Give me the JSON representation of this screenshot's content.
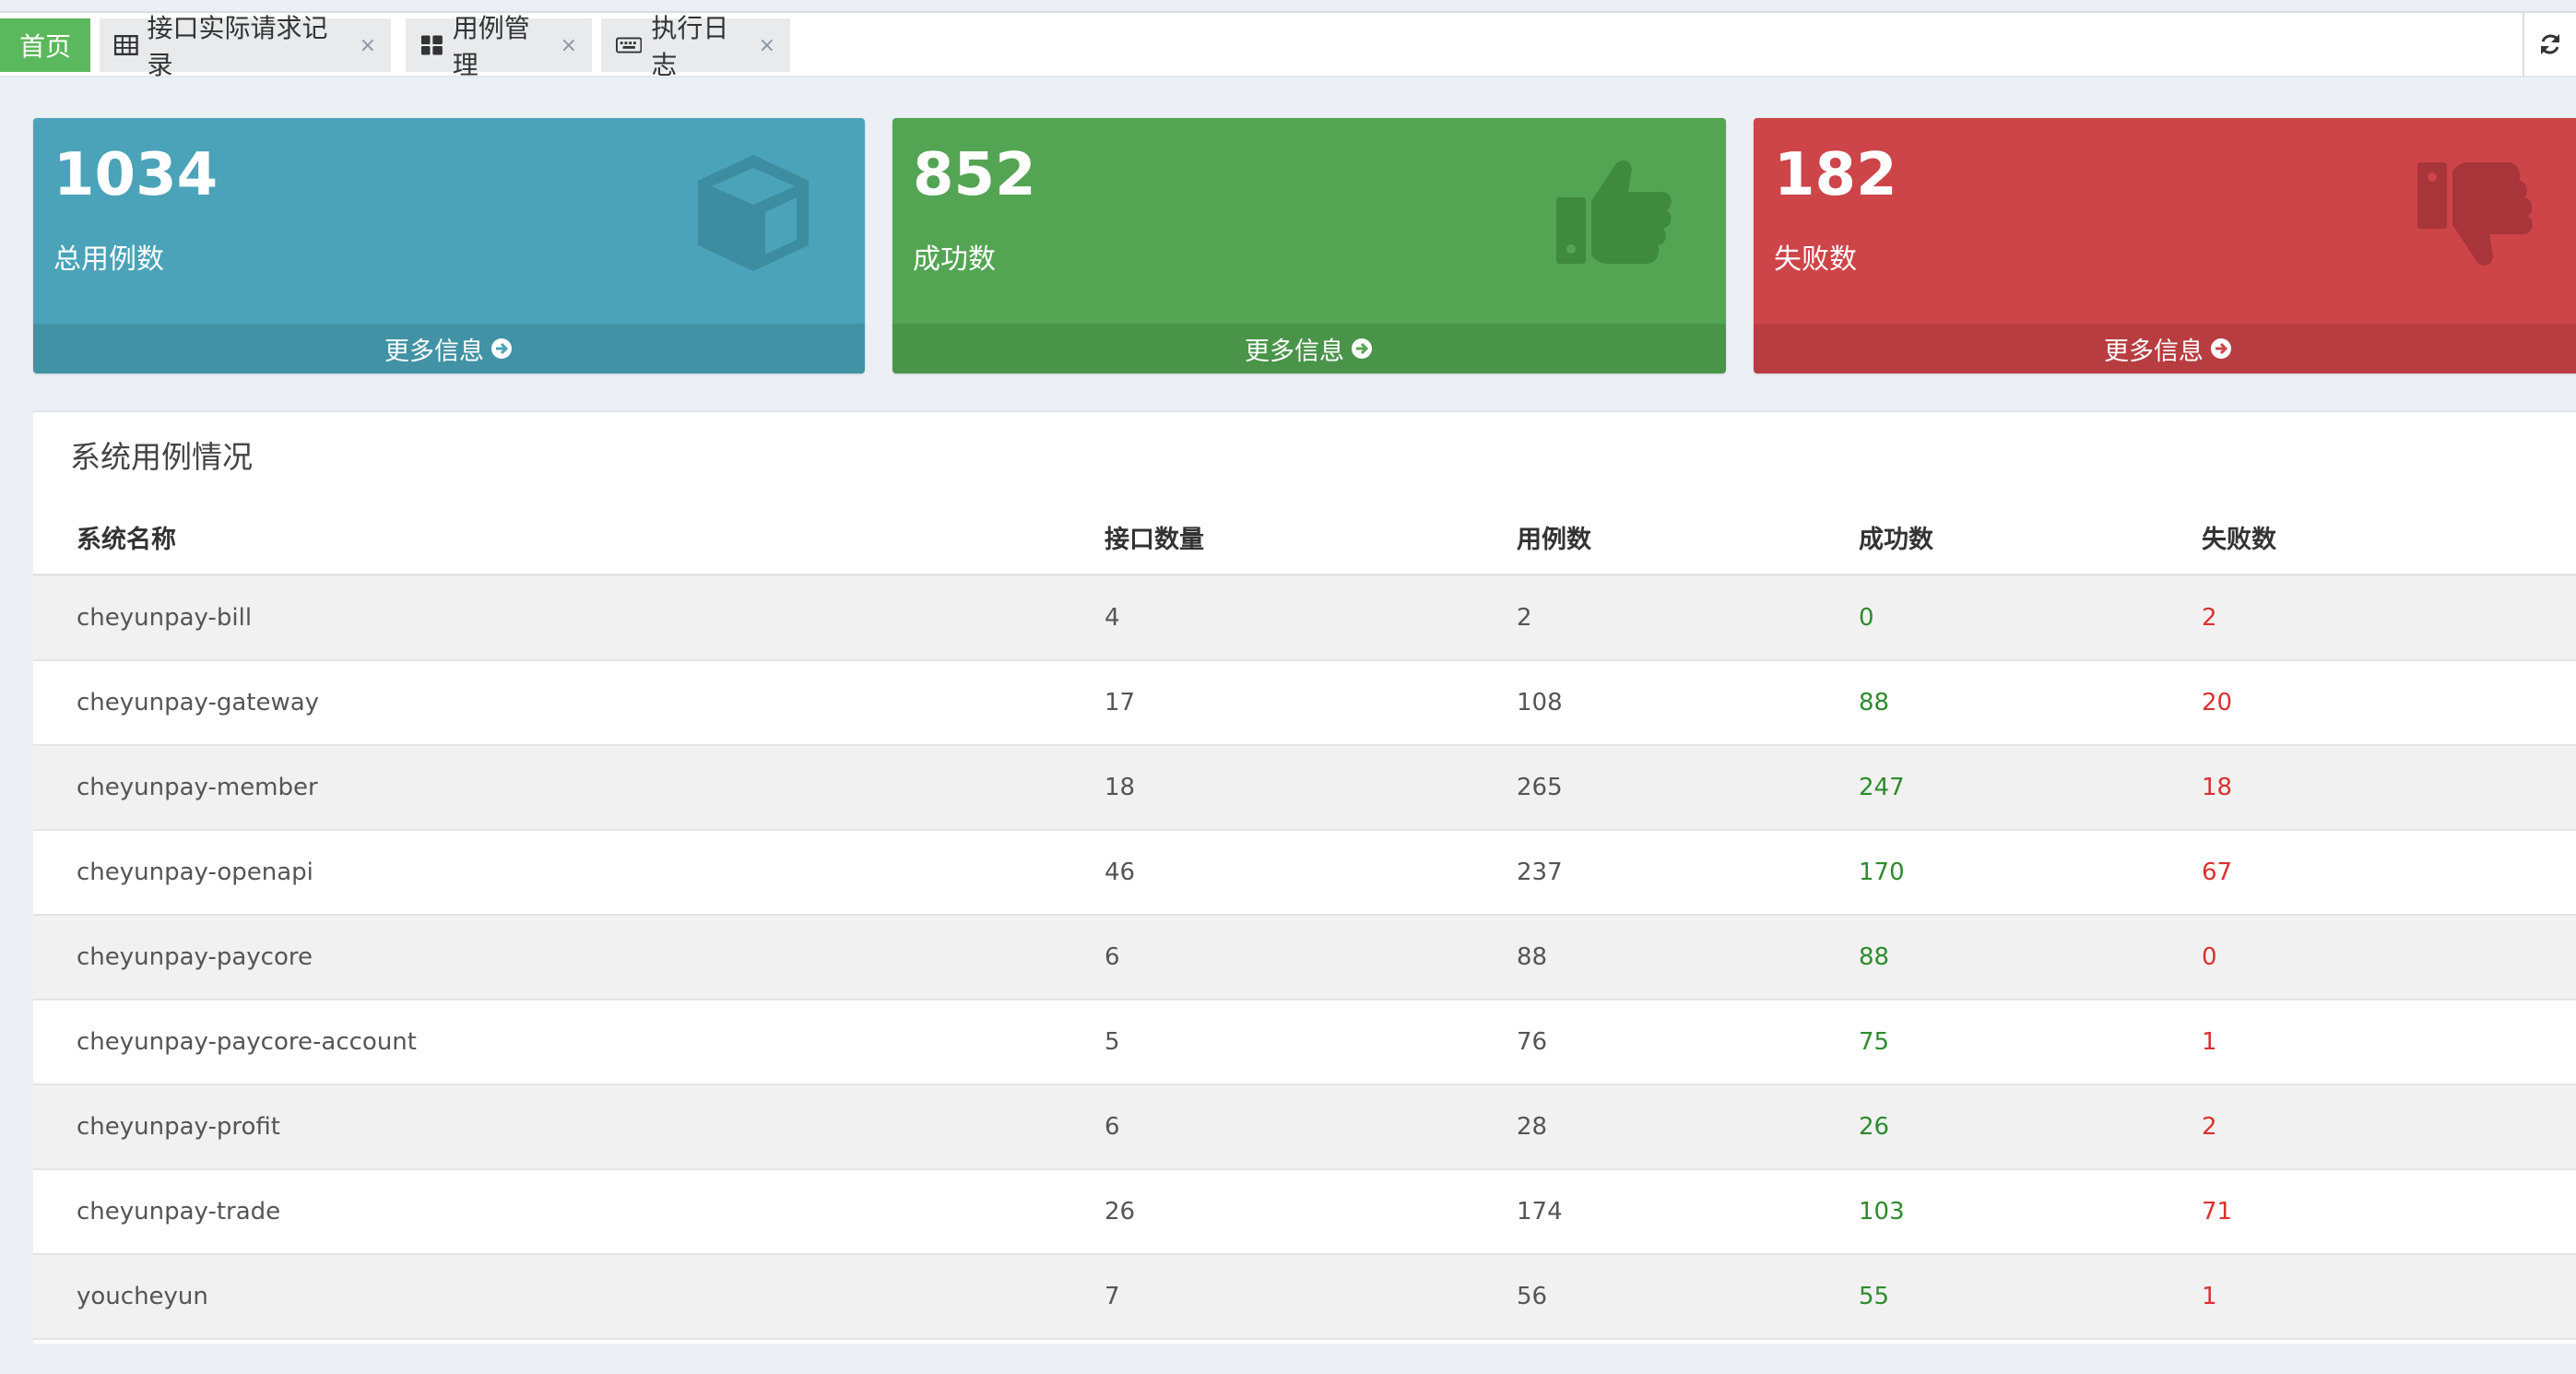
{
  "tabs": {
    "home": "首页",
    "items": [
      {
        "label": "接口实际请求记录",
        "icon": "table-icon"
      },
      {
        "label": "用例管理",
        "icon": "grid-icon"
      },
      {
        "label": "执行日志",
        "icon": "keyboard-icon"
      }
    ],
    "close_symbol": "×"
  },
  "stats": {
    "total": {
      "value": "1034",
      "label": "总用例数",
      "more": "更多信息",
      "color": "#4aa3b8",
      "icon": "cube-icon"
    },
    "success": {
      "value": "852",
      "label": "成功数",
      "more": "更多信息",
      "color": "#53a553",
      "icon": "thumbs-up-icon"
    },
    "fail": {
      "value": "182",
      "label": "失败数",
      "more": "更多信息",
      "color": "#cd4449",
      "icon": "thumbs-down-icon"
    }
  },
  "panel": {
    "title": "系统用例情况",
    "columns": [
      "系统名称",
      "接口数量",
      "用例数",
      "成功数",
      "失败数"
    ],
    "rows": [
      [
        "cheyunpay-bill",
        "4",
        "2",
        "0",
        "2"
      ],
      [
        "cheyunpay-gateway",
        "17",
        "108",
        "88",
        "20"
      ],
      [
        "cheyunpay-member",
        "18",
        "265",
        "247",
        "18"
      ],
      [
        "cheyunpay-openapi",
        "46",
        "237",
        "170",
        "67"
      ],
      [
        "cheyunpay-paycore",
        "6",
        "88",
        "88",
        "0"
      ],
      [
        "cheyunpay-paycore-account",
        "5",
        "76",
        "75",
        "1"
      ],
      [
        "cheyunpay-profit",
        "6",
        "28",
        "26",
        "2"
      ],
      [
        "cheyunpay-trade",
        "26",
        "174",
        "103",
        "71"
      ],
      [
        "youcheyun",
        "7",
        "56",
        "55",
        "1"
      ]
    ]
  },
  "colors": {
    "success_text": "#2e8b2e",
    "fail_text": "#d9322f",
    "active_tab": "#5cb85c"
  }
}
